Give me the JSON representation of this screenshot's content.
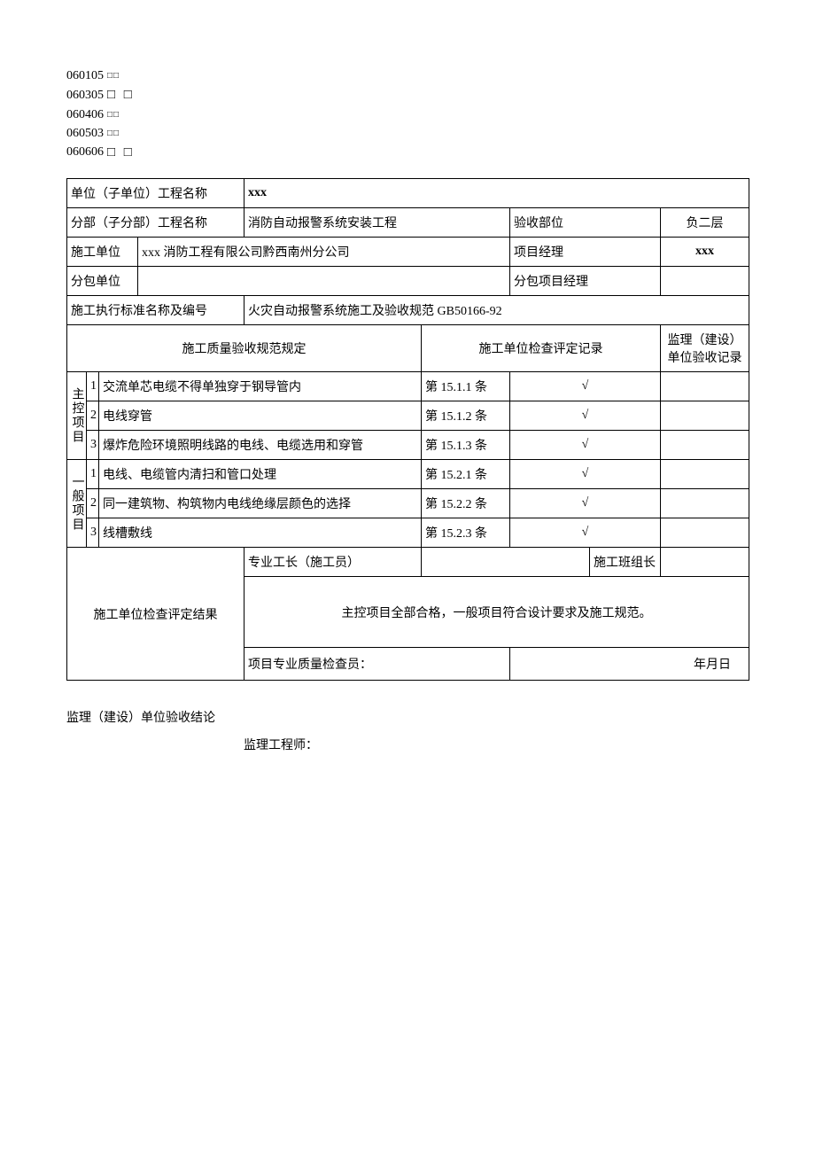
{
  "codes": [
    {
      "num": "060105",
      "boxes": "□□",
      "large": false
    },
    {
      "num": "060305",
      "boxes": "□ □",
      "large": true
    },
    {
      "num": "060406",
      "boxes": "□□",
      "large": false
    },
    {
      "num": "060503",
      "boxes": "□□",
      "large": false
    },
    {
      "num": "060606",
      "boxes": "□ □",
      "large": true
    }
  ],
  "labels": {
    "unit_project_name": "单位（子单位）工程名称",
    "sub_project_name": "分部（子分部）工程名称",
    "acceptance_part": "验收部位",
    "construction_unit": "施工单位",
    "project_manager": "项目经理",
    "subcontractor": "分包单位",
    "sub_pm": "分包项目经理",
    "standard": "施工执行标准名称及编号",
    "quality_spec": "施工质量验收规范规定",
    "check_record": "施工单位检查评定记录",
    "supervisor_record": "监理（建设）单位验收记录",
    "main_control": "主控项目",
    "general": "一般项目",
    "foreman": "专业工长（施工员）",
    "team_leader": "施工班组长",
    "result_label": "施工单位检查评定结果",
    "result_text": "主控项目全部合格，一般项目符合设计要求及施工规范。",
    "inspector": "项目专业质量检查员：",
    "date": "年月日",
    "conclusion": "监理（建设）单位验收结论",
    "engineer": "监理工程师："
  },
  "values": {
    "unit_project_name": "xxx",
    "sub_project_name": "消防自动报警系统安装工程",
    "acceptance_part": "负二层",
    "construction_unit": "xxx 消防工程有限公司黔西南州分公司",
    "project_manager": "xxx",
    "subcontractor": "",
    "sub_pm": "",
    "standard": "火灾自动报警系统施工及验收规范 GB50166-92"
  },
  "main_items": [
    {
      "no": "1",
      "desc": "交流单芯电缆不得单独穿于钢导管内",
      "clause": "第 15.1.1 条",
      "check": "√"
    },
    {
      "no": "2",
      "desc": "电线穿管",
      "clause": "第 15.1.2 条",
      "check": "√"
    },
    {
      "no": "3",
      "desc": "爆炸危险环境照明线路的电线、电缆选用和穿管",
      "clause": "第 15.1.3 条",
      "check": "√"
    }
  ],
  "general_items": [
    {
      "no": "1",
      "desc": "电线、电缆管内清扫和管口处理",
      "clause": "第 15.2.1 条",
      "check": "√"
    },
    {
      "no": "2",
      "desc": "同一建筑物、构筑物内电线绝缘层颜色的选择",
      "clause": "第 15.2.2 条",
      "check": "√"
    },
    {
      "no": "3",
      "desc": "线槽敷线",
      "clause": "第 15.2.3 条",
      "check": "√"
    }
  ]
}
